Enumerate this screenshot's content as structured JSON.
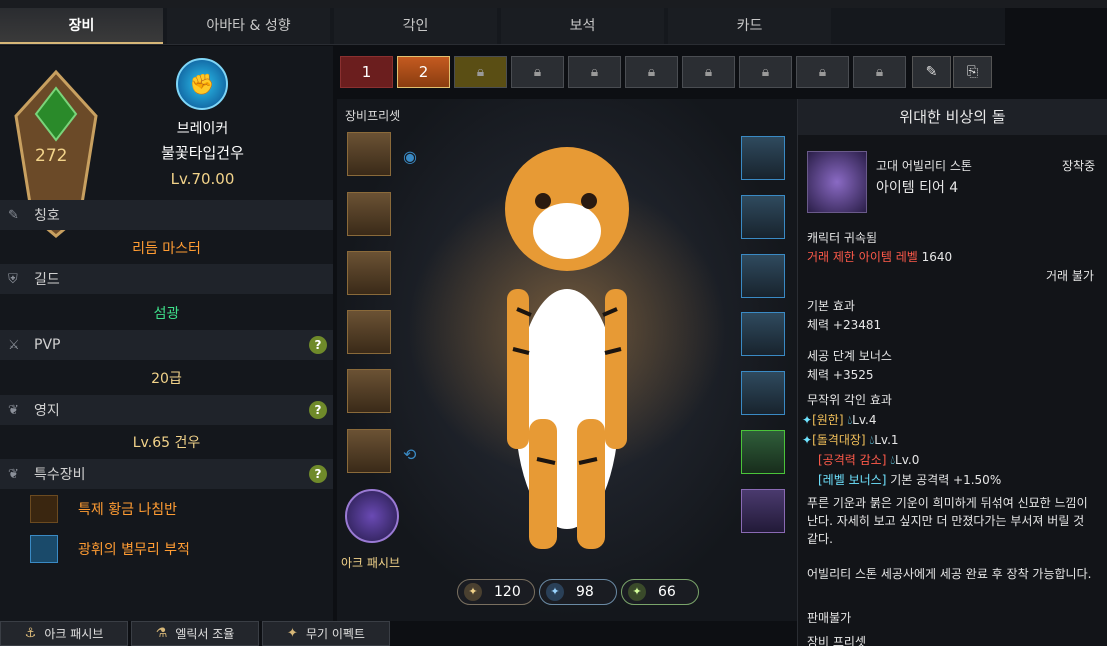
{
  "tabs": [
    "장비",
    "아바타 & 성향",
    "각인",
    "보석",
    "카드"
  ],
  "left": {
    "item_level": "272",
    "class_name": "브레이커",
    "character_name": "불꽃타입건우",
    "level_label": "Lv.70.00",
    "sections": {
      "title": {
        "label": "칭호",
        "value": "리듬 마스터"
      },
      "guild": {
        "label": "길드",
        "value": "섬광"
      },
      "pvp": {
        "label": "PVP",
        "value": "20급"
      },
      "estate": {
        "label": "영지",
        "value": "Lv.65 건우"
      },
      "special": {
        "label": "특수장비"
      }
    },
    "special_items": [
      "특제 황금 나침반",
      "광휘의 별무리 부적"
    ],
    "help_mark": "?"
  },
  "bottom_buttons": [
    "아크 패시브",
    "엘릭서 조율",
    "무기 이펙트"
  ],
  "presets": {
    "p1": "1",
    "p2": "2"
  },
  "center": {
    "preset_label": "장비프리셋",
    "ark_label": "아크 패시브",
    "stats": [
      "120",
      "98",
      "66"
    ]
  },
  "tooltip": {
    "title": "위대한 비상의 돌",
    "category": "고대 어빌리티 스톤",
    "equipped": "장착중",
    "tier": "아이템 티어 4",
    "bound": "캐릭터 귀속됨",
    "trade_limit": "거래 제한 아이템 레벨",
    "trade_limit_value": "1640",
    "no_trade": "거래 불가",
    "base_effect_h": "기본 효과",
    "base_effect": "체력 +23481",
    "bonus_h": "세공 단계 보너스",
    "bonus": "체력 +3525",
    "engr_h": "무작위 각인 효과",
    "engr1_name": "[원한]",
    "engr1_lv": "Lv.4",
    "engr2_name": "[돌격대장]",
    "engr2_lv": "Lv.1",
    "engr3_name": "[공격력 감소]",
    "engr3_lv": "Lv.0",
    "engr4_name": "[레벨 보너스]",
    "engr4_val": "기본 공격력 +1.50%",
    "flavor": "푸른 기운과 붉은 기운이 희미하게 뒤섞여 신묘한 느낌이 난다. 자세히 보고 싶지만 더 만졌다가는 부서져 버릴 것 같다.",
    "note": "어빌리티 스톤 세공사에게 세공 완료 후 장착 가능합니다.",
    "sale": "판매불가",
    "preset": "장비 프리셋"
  }
}
